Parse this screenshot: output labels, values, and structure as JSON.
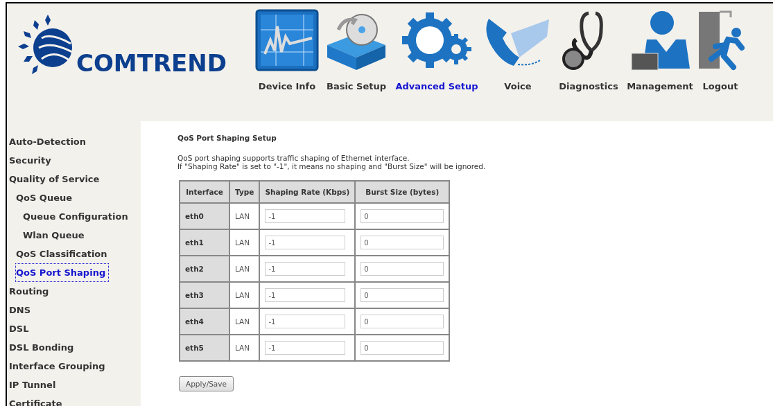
{
  "logo": {
    "text": "COMTREND"
  },
  "nav": [
    {
      "label": "Device Info",
      "kind": "monitor",
      "selected": false
    },
    {
      "label": "Basic Setup",
      "kind": "box",
      "selected": false
    },
    {
      "label": "Advanced Setup",
      "kind": "gear",
      "selected": true
    },
    {
      "label": "Voice",
      "kind": "phone",
      "selected": false
    },
    {
      "label": "Diagnostics",
      "kind": "stethoscope",
      "selected": false
    },
    {
      "label": "Management",
      "kind": "person",
      "selected": false
    },
    {
      "label": "Logout",
      "kind": "exit",
      "selected": false
    }
  ],
  "sidebar": {
    "items": [
      {
        "label": "Auto-Detection",
        "selected": false
      },
      {
        "label": "Security",
        "selected": false
      },
      {
        "label": "Quality of Service",
        "selected": false,
        "children": [
          {
            "label": "QoS Queue",
            "selected": false,
            "children": [
              {
                "label": "Queue Configuration",
                "selected": false
              },
              {
                "label": "Wlan Queue",
                "selected": false
              }
            ]
          },
          {
            "label": "QoS Classification",
            "selected": false
          },
          {
            "label": "QoS Port Shaping",
            "selected": true
          }
        ]
      },
      {
        "label": "Routing",
        "selected": false
      },
      {
        "label": "DNS",
        "selected": false
      },
      {
        "label": "DSL",
        "selected": false
      },
      {
        "label": "DSL Bonding",
        "selected": false
      },
      {
        "label": "Interface Grouping",
        "selected": false
      },
      {
        "label": "IP Tunnel",
        "selected": false
      },
      {
        "label": "Certificate",
        "selected": false
      }
    ]
  },
  "main": {
    "title": "QoS Port Shaping Setup",
    "description": [
      "QoS port shaping supports traffic shaping of Ethernet interface.",
      "If \"Shaping Rate\" is set to \"-1\", it means no shaping and \"Burst Size\" will be ignored."
    ],
    "table": {
      "columns": [
        "Interface",
        "Type",
        "Shaping Rate (Kbps)",
        "Burst Size (bytes)"
      ],
      "rows": [
        {
          "interface": "eth0",
          "type": "LAN",
          "shaping_rate": "-1",
          "burst_size": "0"
        },
        {
          "interface": "eth1",
          "type": "LAN",
          "shaping_rate": "-1",
          "burst_size": "0"
        },
        {
          "interface": "eth2",
          "type": "LAN",
          "shaping_rate": "-1",
          "burst_size": "0"
        },
        {
          "interface": "eth3",
          "type": "LAN",
          "shaping_rate": "-1",
          "burst_size": "0"
        },
        {
          "interface": "eth4",
          "type": "LAN",
          "shaping_rate": "-1",
          "burst_size": "0"
        },
        {
          "interface": "eth5",
          "type": "LAN",
          "shaping_rate": "-1",
          "burst_size": "0"
        }
      ]
    },
    "button": "Apply/Save"
  }
}
